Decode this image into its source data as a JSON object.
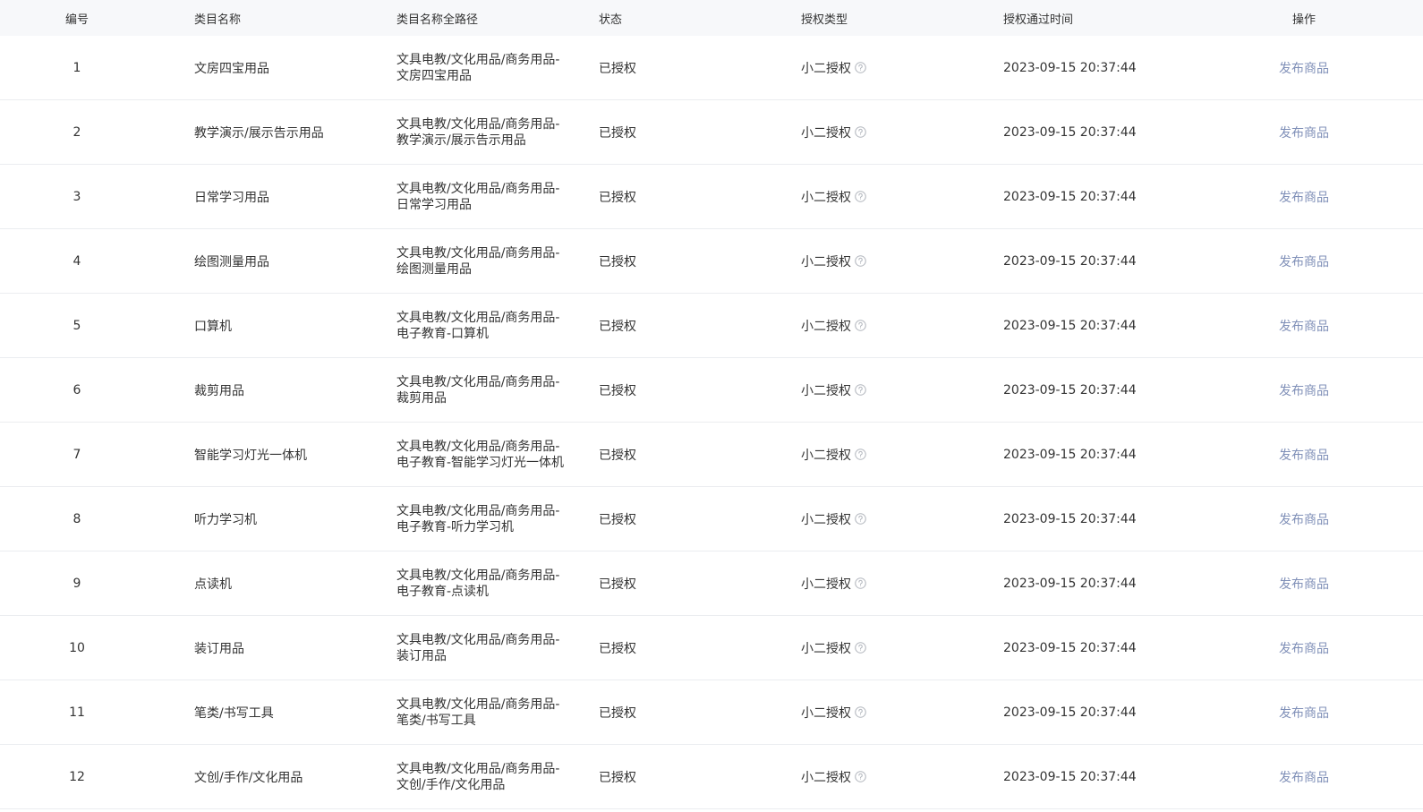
{
  "table": {
    "columns": [
      "编号",
      "类目名称",
      "类目名称全路径",
      "状态",
      "授权类型",
      "授权通过时间",
      "操作"
    ],
    "rows": [
      {
        "id": "1",
        "name": "文房四宝用品",
        "path": [
          "文具电教/文化用品/商务用品-",
          "文房四宝用品"
        ],
        "status": "已授权",
        "auth_type": "小二授权",
        "auth_time": "2023-09-15 20:37:44",
        "action": "发布商品"
      },
      {
        "id": "2",
        "name": "教学演示/展示告示用品",
        "path": [
          "文具电教/文化用品/商务用品-",
          "教学演示/展示告示用品"
        ],
        "status": "已授权",
        "auth_type": "小二授权",
        "auth_time": "2023-09-15 20:37:44",
        "action": "发布商品"
      },
      {
        "id": "3",
        "name": "日常学习用品",
        "path": [
          "文具电教/文化用品/商务用品-",
          "日常学习用品"
        ],
        "status": "已授权",
        "auth_type": "小二授权",
        "auth_time": "2023-09-15 20:37:44",
        "action": "发布商品"
      },
      {
        "id": "4",
        "name": "绘图测量用品",
        "path": [
          "文具电教/文化用品/商务用品-",
          "绘图测量用品"
        ],
        "status": "已授权",
        "auth_type": "小二授权",
        "auth_time": "2023-09-15 20:37:44",
        "action": "发布商品"
      },
      {
        "id": "5",
        "name": "口算机",
        "path": [
          "文具电教/文化用品/商务用品-",
          "电子教育-口算机"
        ],
        "status": "已授权",
        "auth_type": "小二授权",
        "auth_time": "2023-09-15 20:37:44",
        "action": "发布商品"
      },
      {
        "id": "6",
        "name": "裁剪用品",
        "path": [
          "文具电教/文化用品/商务用品-",
          "裁剪用品"
        ],
        "status": "已授权",
        "auth_type": "小二授权",
        "auth_time": "2023-09-15 20:37:44",
        "action": "发布商品"
      },
      {
        "id": "7",
        "name": "智能学习灯光一体机",
        "path": [
          "文具电教/文化用品/商务用品-",
          "电子教育-智能学习灯光一体机"
        ],
        "status": "已授权",
        "auth_type": "小二授权",
        "auth_time": "2023-09-15 20:37:44",
        "action": "发布商品"
      },
      {
        "id": "8",
        "name": "听力学习机",
        "path": [
          "文具电教/文化用品/商务用品-",
          "电子教育-听力学习机"
        ],
        "status": "已授权",
        "auth_type": "小二授权",
        "auth_time": "2023-09-15 20:37:44",
        "action": "发布商品"
      },
      {
        "id": "9",
        "name": "点读机",
        "path": [
          "文具电教/文化用品/商务用品-",
          "电子教育-点读机"
        ],
        "status": "已授权",
        "auth_type": "小二授权",
        "auth_time": "2023-09-15 20:37:44",
        "action": "发布商品"
      },
      {
        "id": "10",
        "name": "装订用品",
        "path": [
          "文具电教/文化用品/商务用品-",
          "装订用品"
        ],
        "status": "已授权",
        "auth_type": "小二授权",
        "auth_time": "2023-09-15 20:37:44",
        "action": "发布商品"
      },
      {
        "id": "11",
        "name": "笔类/书写工具",
        "path": [
          "文具电教/文化用品/商务用品-",
          "笔类/书写工具"
        ],
        "status": "已授权",
        "auth_type": "小二授权",
        "auth_time": "2023-09-15 20:37:44",
        "action": "发布商品"
      },
      {
        "id": "12",
        "name": "文创/手作/文化用品",
        "path": [
          "文具电教/文化用品/商务用品-",
          "文创/手作/文化用品"
        ],
        "status": "已授权",
        "auth_type": "小二授权",
        "auth_time": "2023-09-15 20:37:44",
        "action": "发布商品"
      }
    ]
  },
  "icons": {
    "auth_type_help": "question-circle-icon"
  },
  "colors": {
    "header_background": "#f7f8fa",
    "row_divider": "#ebedf0",
    "text": "#333333",
    "action_link": "#8090b8",
    "help_icon": "#b4b8bf"
  }
}
